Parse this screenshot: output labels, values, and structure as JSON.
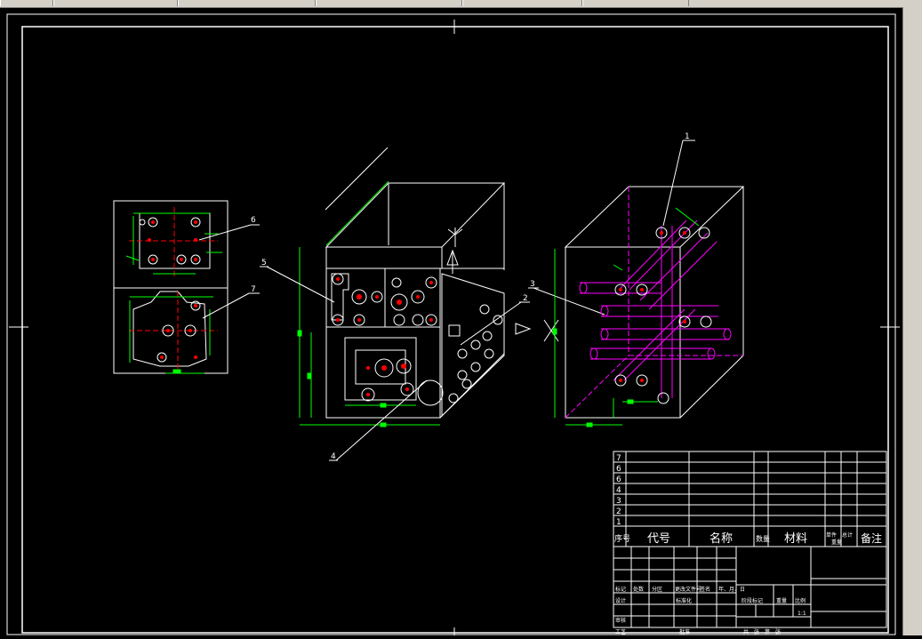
{
  "window": {
    "tabs": [
      "",
      "",
      "",
      "",
      "",
      ""
    ]
  },
  "drawing": {
    "balloons": [
      "1",
      "2",
      "3",
      "4",
      "5",
      "6",
      "7"
    ],
    "colors": {
      "background": "#000000",
      "lines": "#ffffff",
      "dimension": "#00ff00",
      "center": "#ff0000",
      "hidden": "#ff00ff"
    }
  },
  "title_block": {
    "bom_row_numbers": [
      "7",
      "6",
      "6",
      "4",
      "3",
      "2",
      "1"
    ],
    "bom_header": {
      "seq": "序号",
      "code": "代号",
      "name": "名称",
      "qty": "数量",
      "material": "材料",
      "mass_single": "单件",
      "mass_total": "总计",
      "mass_label": "重量",
      "remark": "备注"
    },
    "approval": {
      "r1": [
        "标记",
        "处数",
        "分区",
        "更改文件号",
        "签名",
        "年、月、日"
      ],
      "design": "设计",
      "standardize": "标准化",
      "stage_mark": "阶段标记",
      "weight": "重量",
      "scale": "比例",
      "scale_value": "1:1",
      "review": "审核",
      "process": "工艺",
      "approve": "批准",
      "sheet": "共　张　第　张"
    }
  }
}
